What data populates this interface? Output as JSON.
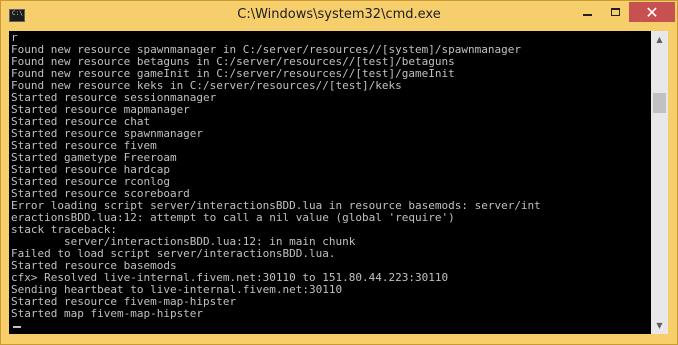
{
  "window": {
    "title": "C:\\Windows\\system32\\cmd.exe",
    "app_icon_text": "C:\\"
  },
  "controls": {
    "minimize": "minimize",
    "maximize": "maximize",
    "close": "✕"
  },
  "console": {
    "lines": [
      "r",
      "Found new resource spawnmanager in C:/server/resources//[system]/spawnmanager",
      "Found new resource betaguns in C:/server/resources//[test]/betaguns",
      "Found new resource gameInit in C:/server/resources//[test]/gameInit",
      "Found new resource keks in C:/server/resources//[test]/keks",
      "Started resource sessionmanager",
      "Started resource mapmanager",
      "Started resource chat",
      "Started resource spawnmanager",
      "Started resource fivem",
      "Started gametype Freeroam",
      "Started resource hardcap",
      "Started resource rconlog",
      "Started resource scoreboard",
      "Error loading script server/interactionsBDD.lua in resource basemods: server/int",
      "eractionsBDD.lua:12: attempt to call a nil value (global 'require')",
      "stack traceback:",
      "        server/interactionsBDD.lua:12: in main chunk",
      "Failed to load script server/interactionsBDD.lua.",
      "Started resource basemods",
      "cfx> Resolved live-internal.fivem.net:30110 to 151.80.44.223:30110",
      "Sending heartbeat to live-internal.fivem.net:30110",
      "Started resource fivem-map-hipster",
      "Started map fivem-map-hipster"
    ]
  },
  "scrollbar": {
    "up_arrow": "▲",
    "down_arrow": "▼"
  }
}
